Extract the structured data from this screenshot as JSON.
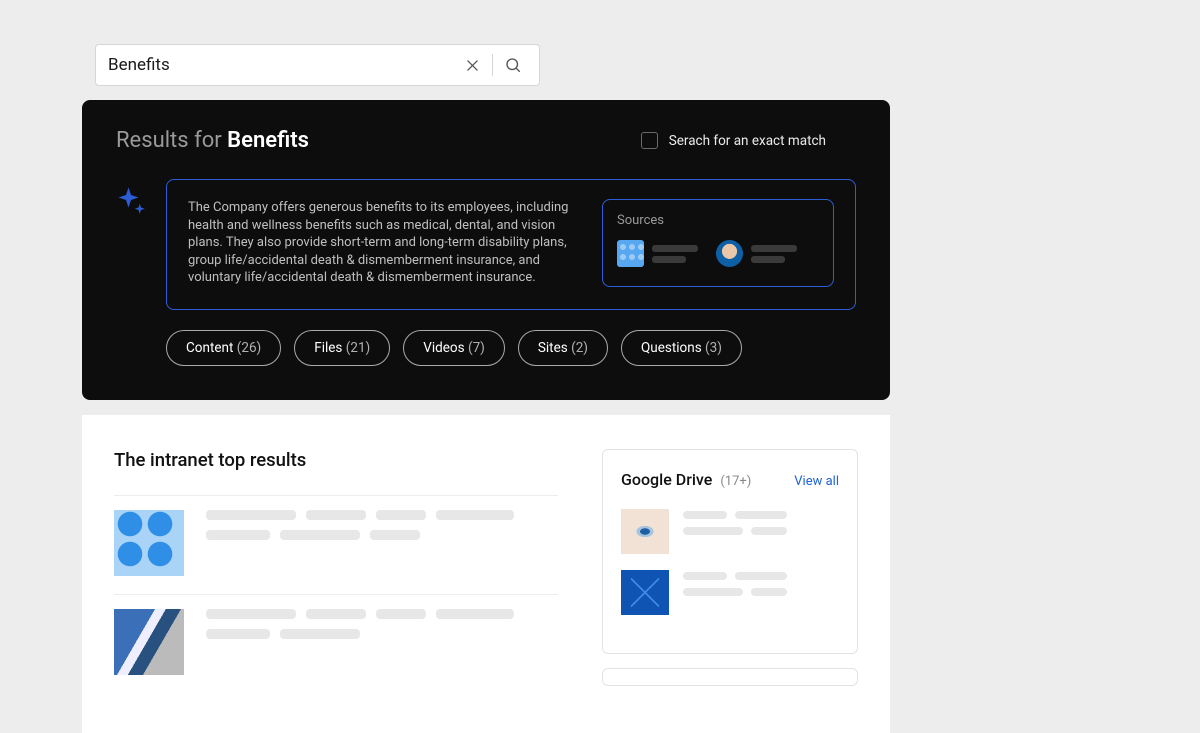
{
  "search": {
    "query": "Benefits"
  },
  "panel": {
    "results_for_prefix": "Results for ",
    "results_for_term": "Benefits",
    "exact_label": "Serach for an exact match"
  },
  "ai": {
    "summary": "The Company offers generous benefits to its employees, including health and wellness benefits such as medical, dental, and vision plans. They also provide short-term and long-term disability plans, group life/accidental death & dismemberment insurance, and voluntary life/accidental death & dismemberment insurance.",
    "sources_label": "Sources"
  },
  "chips": [
    {
      "label": "Content",
      "count": "(26)"
    },
    {
      "label": "Files",
      "count": "(21)"
    },
    {
      "label": "Videos",
      "count": "(7)"
    },
    {
      "label": "Sites",
      "count": "(2)"
    },
    {
      "label": "Questions",
      "count": "(3)"
    }
  ],
  "top_results_title": "The intranet top results",
  "drive": {
    "title": "Google Drive",
    "count": "(17+)",
    "view_all": "View all"
  }
}
